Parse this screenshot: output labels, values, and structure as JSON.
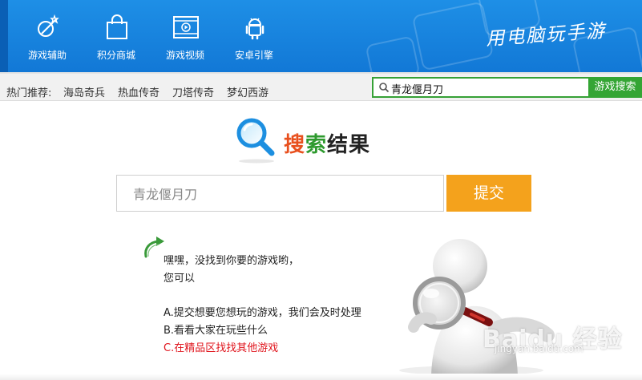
{
  "header": {
    "nav": [
      {
        "label": "游戏辅助",
        "icon": "game-assist-icon"
      },
      {
        "label": "积分商城",
        "icon": "shopping-bag-icon"
      },
      {
        "label": "游戏视频",
        "icon": "video-play-icon"
      },
      {
        "label": "安卓引擎",
        "icon": "android-icon"
      }
    ],
    "slogan": "用电脑玩手游"
  },
  "hotbar": {
    "title": "热门推荐:",
    "links": [
      "海岛奇兵",
      "热血传奇",
      "刀塔传奇",
      "梦幻西游"
    ]
  },
  "top_search": {
    "value": "青龙偃月刀",
    "button": "游戏搜索"
  },
  "result": {
    "title_part1": "搜",
    "title_part2": "索",
    "title_part3": "结果"
  },
  "main_search": {
    "value": "青龙偃月刀",
    "submit": "提交"
  },
  "message": {
    "line1": "嘿嘿，没找到你要的游戏哟，",
    "line2": "您可以",
    "option_a": "A.提交想要您想玩的游戏，我们会及时处理",
    "option_b": "B.看看大家在玩些什么",
    "option_c": "C.在精品区找找其他游戏"
  },
  "watermark": {
    "brand": "Baidu 经验",
    "url": "jingyan.baidu.com"
  },
  "colors": {
    "header_blue": "#1278d6",
    "search_green": "#34a534",
    "submit_orange": "#f4a21c",
    "alert_red": "#e0141c"
  }
}
